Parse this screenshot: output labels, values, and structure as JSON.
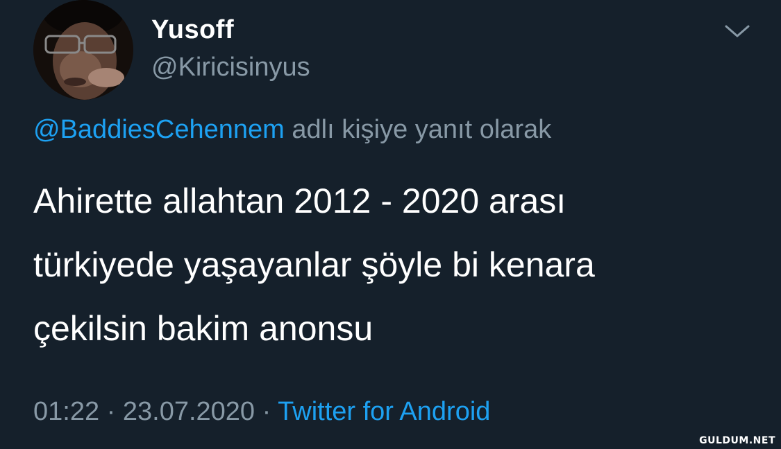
{
  "author": {
    "display_name": "Yusoff",
    "handle": "@Kiricisinyus"
  },
  "reply_context": {
    "mention": "@BaddiesCehennem",
    "suffix": " adlı kişiye yanıt olarak"
  },
  "tweet": {
    "lines": [
      "Ahirette allahtan 2012 - 2020 arası",
      "türkiyede yaşayanlar şöyle bi kenara",
      "çekilsin bakim anonsu"
    ]
  },
  "meta": {
    "time": "01:22",
    "separator": "·",
    "date": "23.07.2020",
    "source": "Twitter for Android"
  },
  "icons": {
    "menu": "chevron-down-icon"
  },
  "colors": {
    "background": "#15202b",
    "primary_text": "#ffffff",
    "secondary_text": "#8899a6",
    "accent": "#1da1f2"
  },
  "watermark": "GULDUM.NET"
}
